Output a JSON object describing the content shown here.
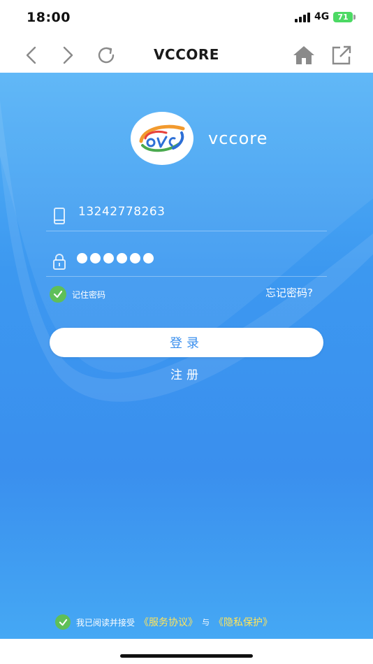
{
  "status_bar": {
    "time": "18:00",
    "network": "4G",
    "battery": "71"
  },
  "toolbar": {
    "title": "VCCORE",
    "icons": [
      "back-icon",
      "forward-icon",
      "refresh-icon",
      "home-icon",
      "share-icon"
    ]
  },
  "logo": {
    "text": "vccore"
  },
  "form": {
    "phone_value": "13242778263",
    "password_value": "••••••",
    "remember_label": "记住密码",
    "forgot_label": "忘记密码?",
    "login_label": "登录",
    "register_label": "注册"
  },
  "agreement": {
    "prefix": "我已阅读并接受",
    "service_link": "《服务协议》",
    "and": "与",
    "privacy_link": "《隐私保护》"
  },
  "colors": {
    "accent": "#3a8fee",
    "check": "#5fbf58",
    "link": "#ffe45a"
  }
}
